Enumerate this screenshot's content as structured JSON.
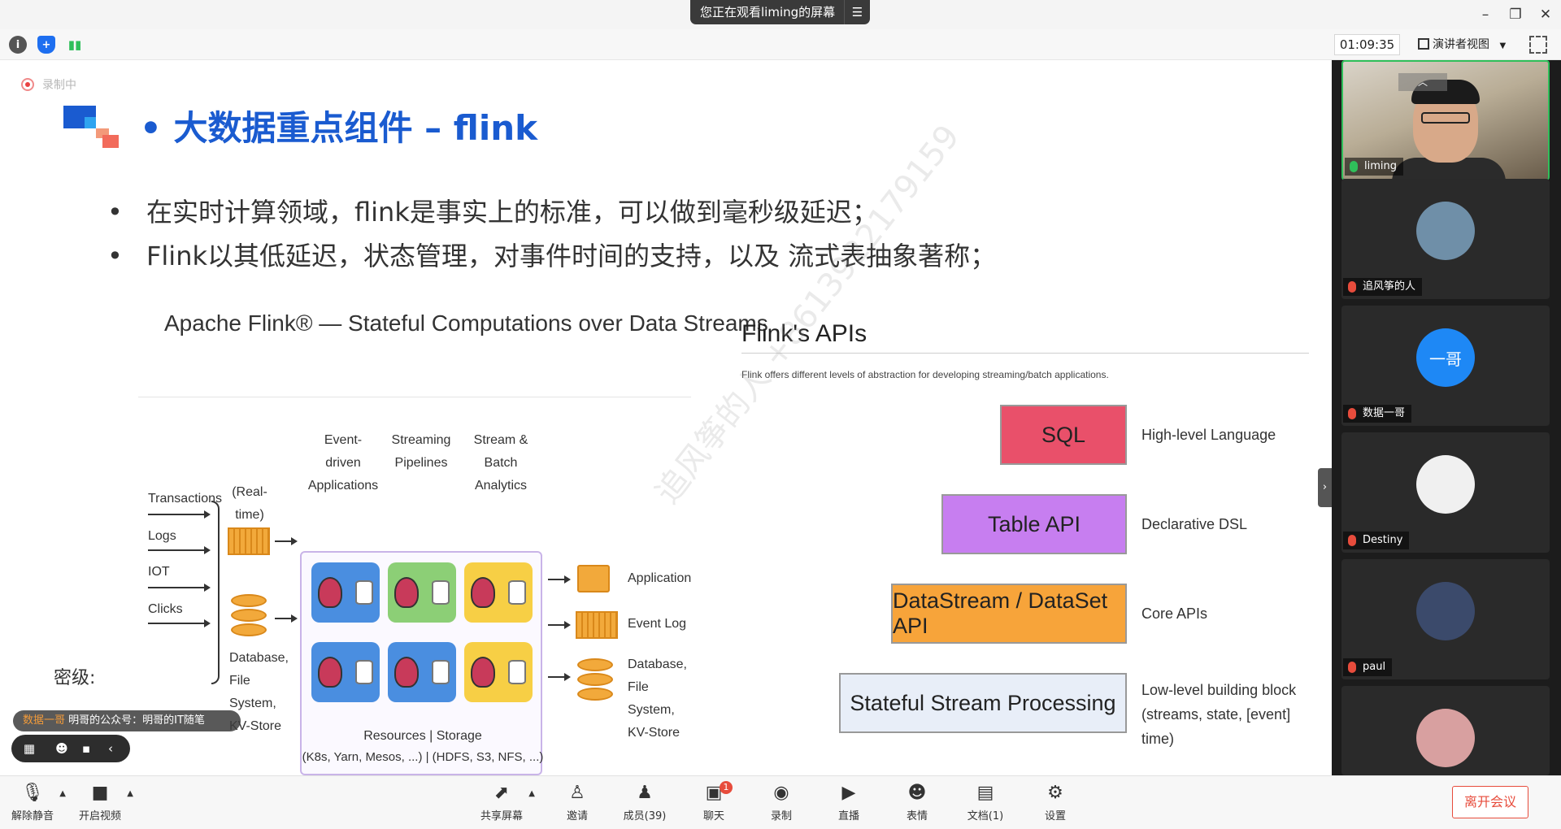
{
  "window": {
    "share_banner": "您正在观看liming的屏幕",
    "share_menu_icon": "menu-icon",
    "minimize_icon": "minimize-icon",
    "restore_icon": "restore-icon",
    "close_icon": "close-icon"
  },
  "meeting_bar": {
    "timer": "01:09:35",
    "view_label": "演讲者视图",
    "icons": [
      "info-icon",
      "shield-icon",
      "signal-icon",
      "fullscreen-icon"
    ]
  },
  "slide": {
    "recording_label": "录制中",
    "title": "• 大数据重点组件 – flink",
    "bullets": [
      "在实时计算领域，flink是事实上的标准，可以做到毫秒级延迟；",
      "Flink以其低延迟，状态管理，对事件时间的支持，以及 流式表抽象著称；"
    ],
    "left_diagram": {
      "heading": "Apache Flink® — Stateful Computations over Data Streams",
      "top_labels": [
        "Event-driven Applications",
        "Streaming Pipelines",
        "Stream & Batch Analytics"
      ],
      "sources": [
        "Transactions",
        "Logs",
        "IOT",
        "Clicks"
      ],
      "realtime_events": "(Real-time) Events",
      "left_db": "Database, File System, KV-Store",
      "resources": "Resources | Storage",
      "resources_detail": "(K8s, Yarn, Mesos, ...) | (HDFS, S3, NFS, ...)",
      "outputs": [
        "Application",
        "Event Log",
        "Database, File System, KV-Store"
      ]
    },
    "right_diagram": {
      "title": "Flink's APIs",
      "subtitle": "Flink offers different levels of abstraction for developing streaming/batch applications.",
      "layers": [
        {
          "label": "SQL",
          "desc": "High-level Language",
          "color": "#e9506a"
        },
        {
          "label": "Table API",
          "desc": "Declarative DSL",
          "color": "#c77ef0"
        },
        {
          "label": "DataStream / DataSet API",
          "desc": "Core APIs",
          "color": "#f7a43a"
        },
        {
          "label": "Stateful Stream Processing",
          "desc": "Low-level building block (streams, state, [event] time)",
          "color": "#e8eef8"
        }
      ]
    },
    "watermark": "追风筝的人 +8613922179159",
    "classification": "密级:"
  },
  "overlays": {
    "speaker_name": "数据一哥",
    "speaker_note": "明哥的公众号：明哥的IT随笔",
    "mini_toolbar_icons": [
      "layout-icon",
      "emoji-icon",
      "chat-icon",
      "collapse-icon"
    ],
    "side_handle_icon": "expand-icon"
  },
  "participants": [
    {
      "name": "liming",
      "type": "video",
      "muted": false
    },
    {
      "name": "追风筝的人",
      "type": "avatar",
      "muted": true,
      "avatar_color": "#6f8fa8"
    },
    {
      "name": "数据一哥",
      "type": "initials",
      "initials": "一哥",
      "muted": true,
      "avatar_color": "#1e88f5"
    },
    {
      "name": "Destiny",
      "type": "avatar",
      "muted": true,
      "avatar_color": "#f0f0f0"
    },
    {
      "name": "paul",
      "type": "avatar",
      "muted": true,
      "avatar_color": "#3b4a6b"
    },
    {
      "name": "",
      "type": "avatar",
      "muted": true,
      "avatar_color": "#d8a0a0"
    }
  ],
  "controls": {
    "unmute": "解除静音",
    "start_video": "开启视频",
    "share": "共享屏幕",
    "invite": "邀请",
    "members": "成员(39)",
    "chat": "聊天",
    "chat_badge": "1",
    "record": "录制",
    "live": "直播",
    "reactions": "表情",
    "docs": "文档(1)",
    "settings": "设置",
    "leave": "离开会议"
  }
}
